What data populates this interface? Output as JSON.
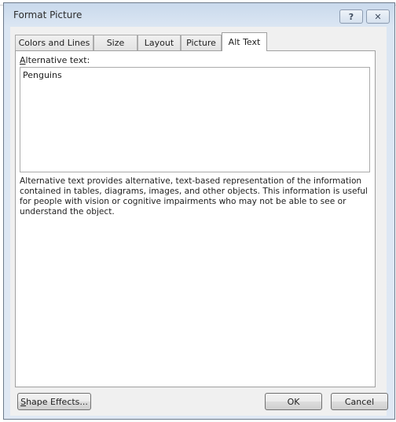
{
  "dialog": {
    "title": "Format Picture",
    "help_icon": "question-mark-icon",
    "help_glyph": "?",
    "close_icon": "close-x-icon",
    "close_glyph": "✕"
  },
  "tabs": [
    {
      "label": "Colors and Lines",
      "active": false
    },
    {
      "label": "Size",
      "active": false
    },
    {
      "label": "Layout",
      "active": false
    },
    {
      "label": "Picture",
      "active": false
    },
    {
      "label": "Alt Text",
      "active": true
    }
  ],
  "alt_text": {
    "label_accel": "A",
    "label_rest": "lternative text:",
    "value": "Penguins",
    "description": "Alternative text provides alternative, text-based representation of the information contained in tables, diagrams, images, and other objects.  This information is useful for people with vision or cognitive impairments who may not be able to see or understand the object."
  },
  "buttons": {
    "shape_effects_accel": "S",
    "shape_effects_rest": "hape Effects...",
    "ok": "OK",
    "cancel": "Cancel"
  }
}
